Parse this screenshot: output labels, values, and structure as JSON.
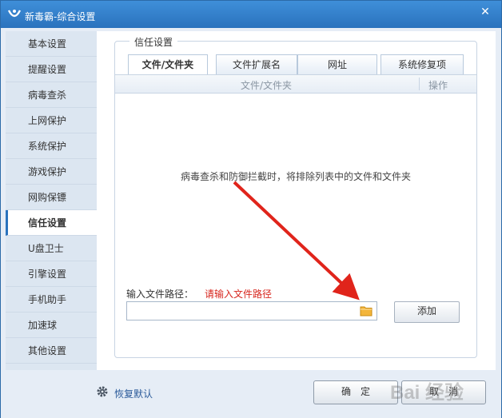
{
  "window": {
    "title": "新毒霸-综合设置",
    "close_symbol": "✕"
  },
  "sidebar": {
    "items": [
      {
        "label": "基本设置"
      },
      {
        "label": "提醒设置"
      },
      {
        "label": "病毒查杀"
      },
      {
        "label": "上网保护"
      },
      {
        "label": "系统保护"
      },
      {
        "label": "游戏保护"
      },
      {
        "label": "网购保镖"
      },
      {
        "label": "信任设置",
        "active": true
      },
      {
        "label": "U盘卫士"
      },
      {
        "label": "引擎设置"
      },
      {
        "label": "手机助手"
      },
      {
        "label": "加速球"
      },
      {
        "label": "其他设置"
      }
    ]
  },
  "trust": {
    "group_title": "信任设置",
    "tabs": [
      {
        "label": "文件/文件夹",
        "active": true
      },
      {
        "label": "文件扩展名"
      },
      {
        "label": "网址"
      },
      {
        "label": "系统修复项"
      }
    ],
    "table_header": {
      "file": "文件/文件夹",
      "action": "操作"
    },
    "empty_message": "病毒查杀和防御拦截时，将排除列表中的文件和文件夹",
    "path_label": "输入文件路径：",
    "path_hint": "请输入文件路径",
    "path_value": "",
    "add_button": "添加"
  },
  "footer": {
    "reset_label": "恢复默认",
    "ok_button": "确　定",
    "cancel_button": "取　消"
  },
  "watermark_text": "Bai 经验",
  "colors": {
    "titlebar": "#2a72bd",
    "accent": "#2a72bd",
    "hint_red": "#d7261e",
    "annotation_arrow": "#e0241b"
  },
  "icons": [
    "app-logo-icon",
    "close-icon",
    "folder-icon",
    "gear-icon"
  ]
}
